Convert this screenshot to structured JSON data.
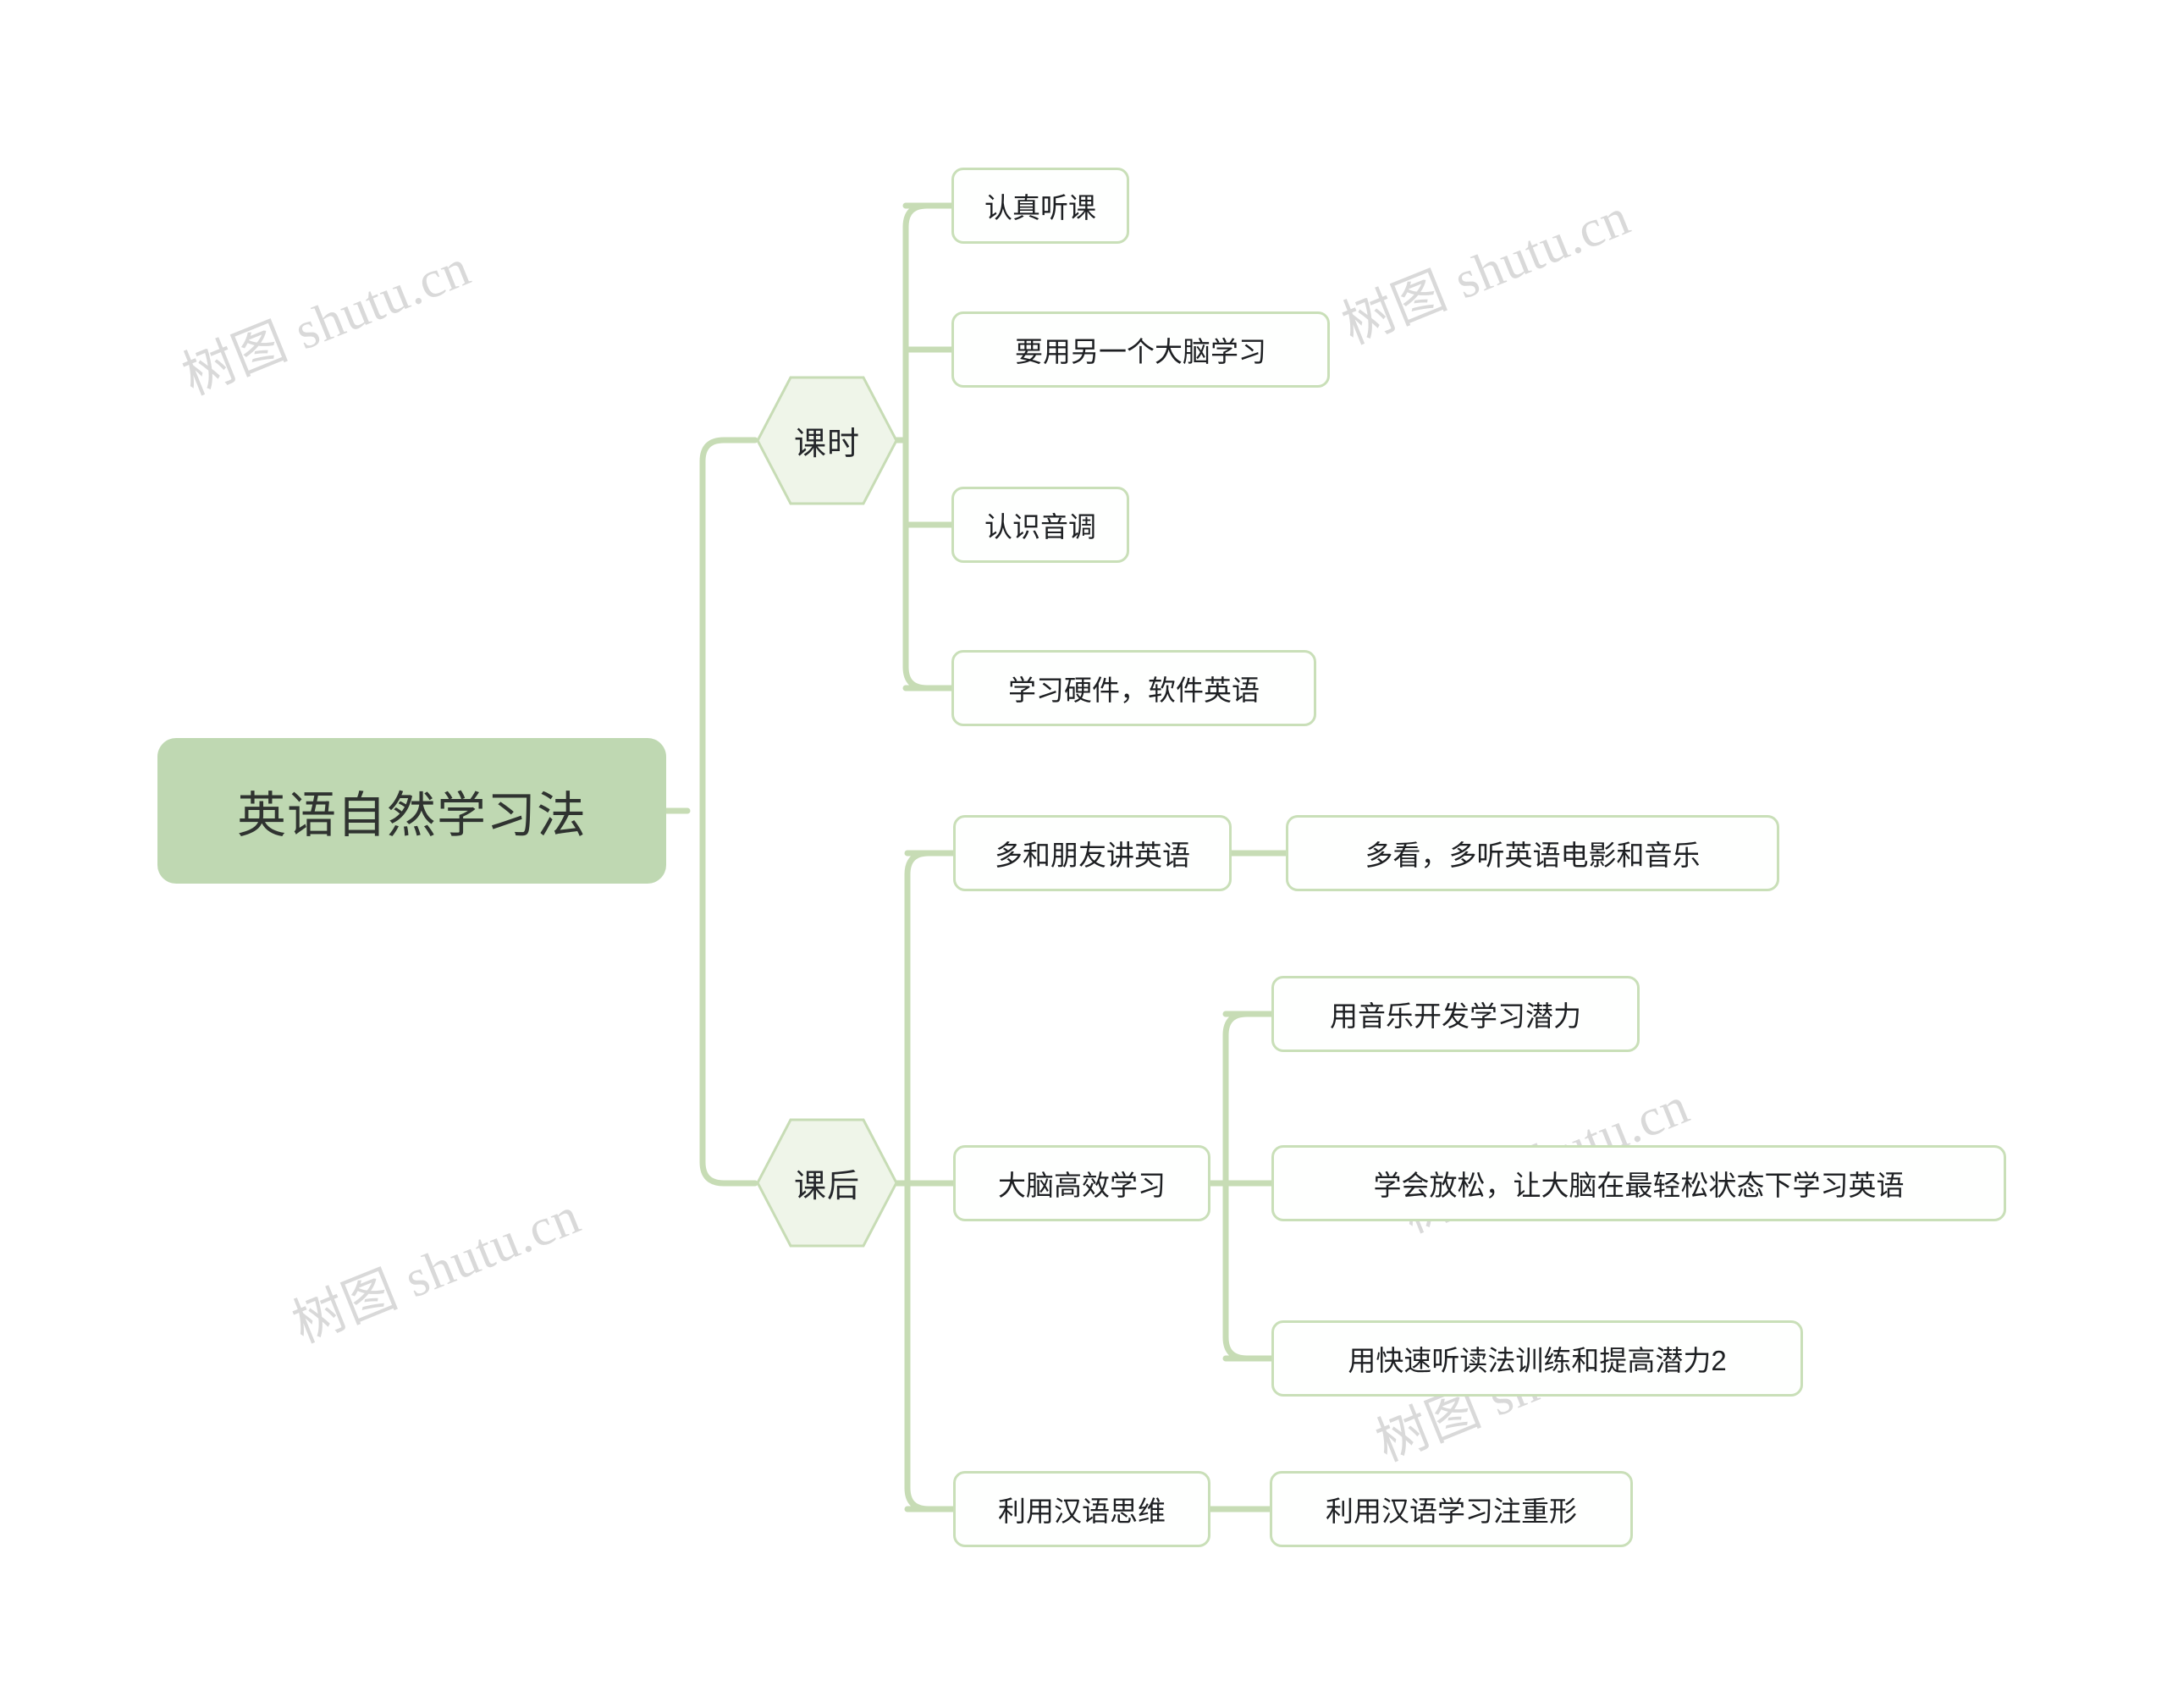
{
  "diagram": {
    "type": "mind-map",
    "title": "英语自然学习法",
    "watermark_text": "树图 shutu.cn",
    "colors": {
      "root_fill": "#bfd8b2",
      "branch_fill": "#eff5e9",
      "branch_stroke": "#c7dcb5",
      "leaf_fill": "#ffffff",
      "leaf_stroke": "#c9dfb8",
      "connector": "#c7dcb5",
      "text": "#24262a",
      "watermark": "#d9d9d9",
      "background": "#ffffff"
    },
    "root": {
      "label": "英语自然学习法"
    },
    "branches": [
      {
        "label": "课时",
        "children": [
          {
            "label": "认真听课",
            "children": []
          },
          {
            "label": "要用另一个大脑学习",
            "children": []
          },
          {
            "label": "认识音调",
            "children": []
          },
          {
            "label": "学习硬件，软件英语",
            "children": []
          }
        ]
      },
      {
        "label": "课后",
        "children": [
          {
            "label": "多和朋友讲英语",
            "children": [
              {
                "label": "多看，多听英语电影和音乐"
              }
            ]
          },
          {
            "label": "大脑高效学习",
            "children": [
              {
                "label": "用音乐开发学习潜力"
              },
              {
                "label": "学会放松，让大脑在最轻松状态下学习英语"
              },
              {
                "label": "用快速听读法训练和提高潜力2"
              }
            ]
          },
          {
            "label": "利用汉语思维",
            "children": [
              {
                "label": "利用汉语学习注重形"
              }
            ]
          }
        ]
      }
    ]
  }
}
